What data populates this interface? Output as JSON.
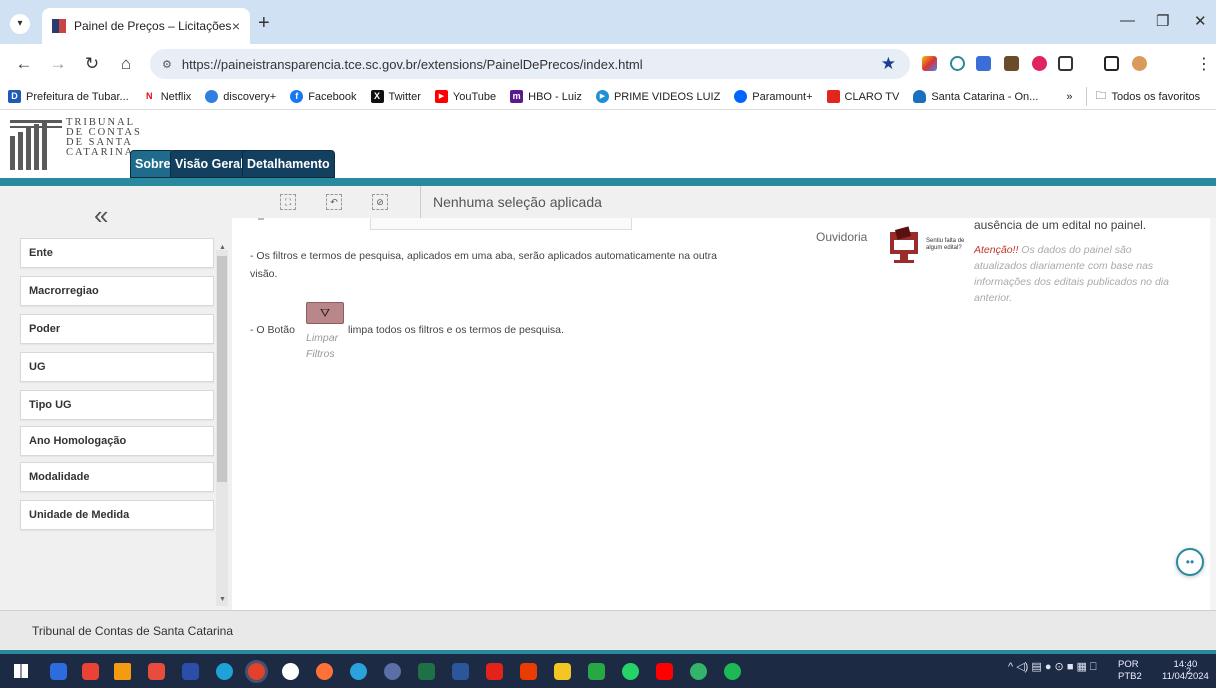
{
  "browser": {
    "tab_title": "Painel de Preços – Licitações",
    "tab_close": "×",
    "new_tab": "+",
    "url": "https://paineistransparencia.tce.sc.gov.br/extensions/PainelDePrecos/index.html",
    "bookmarks": [
      {
        "label": "Prefeitura de Tubar...",
        "color": "#1e5bb8",
        "glyph": "D"
      },
      {
        "label": "Netflix",
        "color": "#e50914",
        "glyph": "N"
      },
      {
        "label": "discovery+",
        "color": "#2f7ee0",
        "glyph": ""
      },
      {
        "label": "Facebook",
        "color": "#1877f2",
        "glyph": "f"
      },
      {
        "label": "Twitter",
        "color": "#111111",
        "glyph": "X"
      },
      {
        "label": "YouTube",
        "color": "#ff0000",
        "glyph": "▶"
      },
      {
        "label": "HBO - Luiz",
        "color": "#5b1a8c",
        "glyph": "m"
      },
      {
        "label": "PRIME VIDEOS LUIZ",
        "color": "#1f8fd6",
        "glyph": "▶"
      },
      {
        "label": "Paramount+",
        "color": "#0064ff",
        "glyph": ""
      },
      {
        "label": "CLARO TV",
        "color": "#e3261b",
        "glyph": ""
      },
      {
        "label": "Santa Catarina - On...",
        "color": "#1a6fbf",
        "glyph": ""
      }
    ],
    "bookmarks_more": "»",
    "all_favorites": "Todos os favoritos"
  },
  "site": {
    "logo_lines": [
      "TRIBUNAL",
      "DE CONTAS",
      "DE SANTA",
      "CATARINA"
    ],
    "tabs": [
      "Sobre",
      "Visão Geral",
      "Detalhamento"
    ],
    "selection_text": "Nenhuma seleção aplicada",
    "filters": [
      "Ente",
      "Macrorregiao",
      "Poder",
      "UG",
      "Tipo UG",
      "Ano Homologação",
      "Modalidade",
      "Unidade de Medida"
    ],
    "content": {
      "filters_note_line1": "- Os filtros e termos de pesquisa, aplicados em uma aba, serão aplicados automaticamente na outra",
      "filters_note_line2": "visão.",
      "button_prefix": "- O Botão",
      "button_suffix": "limpa todos os filtros e os termos de pesquisa.",
      "clear_label_1": "Limpar",
      "clear_label_2": "Filtros",
      "ouvidoria": "Ouvidoria",
      "ouv_icon_text_1": "Sentiu falta de",
      "ouv_icon_text_2": "algum edital?",
      "edital_line": "ausência de um edital no painel.",
      "atencao_label": "Atenção!!",
      "atencao_line1": "Os dados do painel são",
      "atencao_line2": "atualizados diariamente com base nas",
      "atencao_line3": "informações dos editais publicados no dia",
      "atencao_line4": "anterior."
    },
    "footer": "Tribunal de Contas de Santa Catarina"
  },
  "taskbar": {
    "lang_1": "POR",
    "lang_2": "PTB2",
    "time": "14:40",
    "date": "11/04/2024",
    "notifications": "2"
  },
  "colors": {
    "brand_dark": "#13405f",
    "brand_teal": "#2a8a9d",
    "atencao_red": "#c0392b"
  }
}
